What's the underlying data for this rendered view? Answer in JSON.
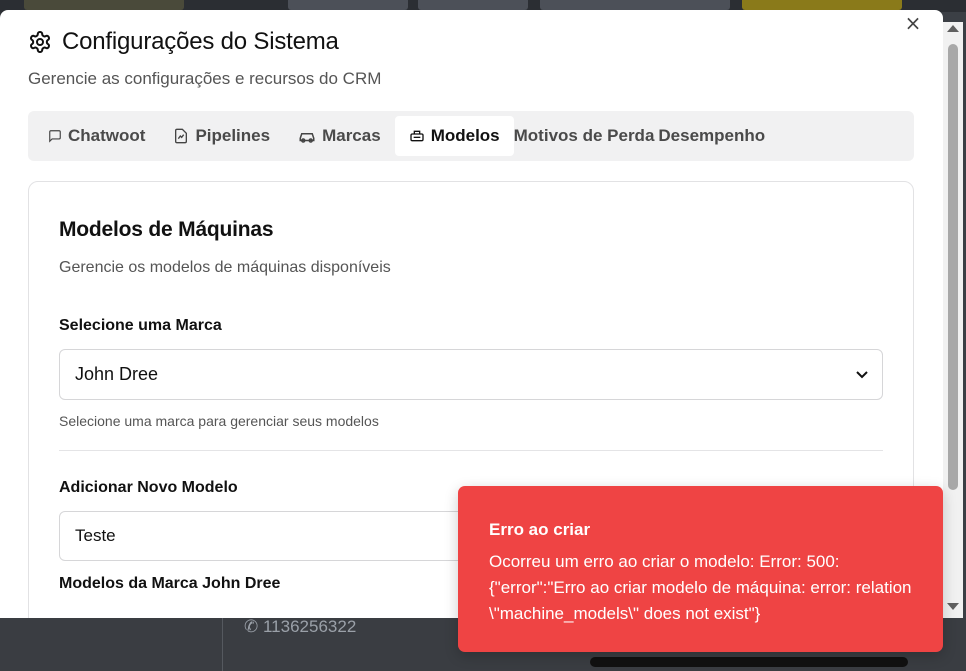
{
  "background": {
    "phone": "1136256322"
  },
  "modal": {
    "title": "Configurações do Sistema",
    "subtitle": "Gerencie as configurações e recursos do CRM",
    "close_label": "×"
  },
  "tabs": [
    {
      "label": "Chatwoot",
      "icon": "chat-icon",
      "active": false
    },
    {
      "label": "Pipelines",
      "icon": "chart-icon",
      "active": false
    },
    {
      "label": "Marcas",
      "icon": "car-icon",
      "active": false
    },
    {
      "label": "Modelos",
      "icon": "machine-icon",
      "active": true
    },
    {
      "label": "Motivos de Perda",
      "icon": "",
      "active": false
    },
    {
      "label": "Desempenho",
      "icon": "",
      "active": false
    }
  ],
  "card": {
    "title": "Modelos de Máquinas",
    "description": "Gerencie os modelos de máquinas disponíveis",
    "brand_label": "Selecione uma Marca",
    "brand_selected": "John Dree",
    "brand_help": "Selecione uma marca para gerenciar seus modelos",
    "new_model_label": "Adicionar Novo Modelo",
    "new_model_value": "Teste",
    "models_heading": "Modelos da Marca John Dree"
  },
  "toast": {
    "title": "Erro ao criar",
    "message": "Ocorreu um erro ao criar o modelo: Error: 500: {\"error\":\"Erro ao criar modelo de máquina: error: relation \\\"machine_models\\\" does not exist\"}",
    "color": "#ef4444"
  }
}
